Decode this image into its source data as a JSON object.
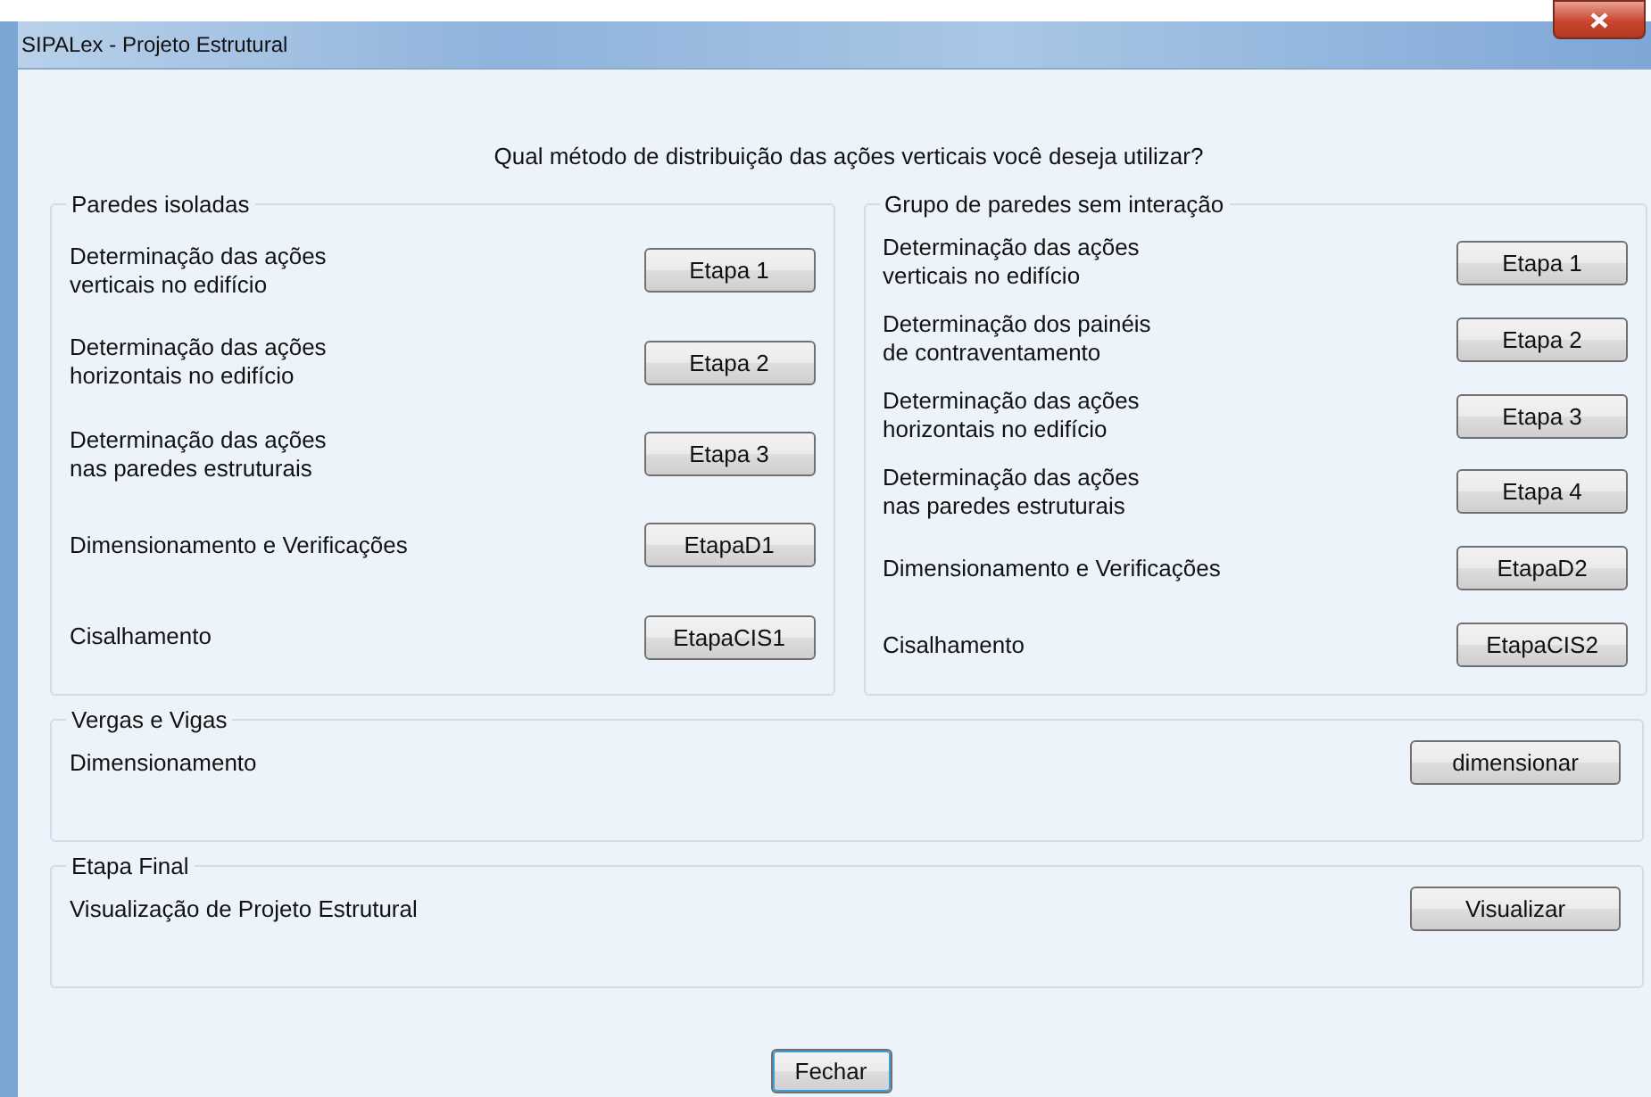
{
  "window": {
    "title": "SIPALex - Projeto Estrutural"
  },
  "question": "Qual método de distribuição das ações verticais você deseja utilizar?",
  "groups": [
    {
      "title": "Paredes isoladas",
      "rows": [
        {
          "label": "Determinação das ações\nverticais no edifício",
          "button": "Etapa 1"
        },
        {
          "label": "Determinação das ações\nhorizontais no edifício",
          "button": "Etapa 2"
        },
        {
          "label": "Determinação das ações\nnas paredes estruturais",
          "button": "Etapa 3"
        },
        {
          "label": "Dimensionamento e Verificações",
          "button": "EtapaD1"
        },
        {
          "label": "Cisalhamento",
          "button": "EtapaCIS1"
        }
      ]
    },
    {
      "title": "Grupo de paredes sem interação",
      "rows": [
        {
          "label": "Determinação das ações\nverticais no edifício",
          "button": "Etapa 1"
        },
        {
          "label": "Determinação dos painéis\nde contraventamento",
          "button": "Etapa 2"
        },
        {
          "label": "Determinação das ações\nhorizontais no edifício",
          "button": "Etapa 3"
        },
        {
          "label": "Determinação das ações\nnas paredes estruturais",
          "button": "Etapa 4"
        },
        {
          "label": "Dimensionamento e Verificações",
          "button": "EtapaD2"
        },
        {
          "label": "Cisalhamento",
          "button": "EtapaCIS2"
        }
      ]
    }
  ],
  "sections": [
    {
      "title": "Vergas e Vigas",
      "label": "Dimensionamento",
      "button": "dimensionar"
    },
    {
      "title": "Etapa Final",
      "label": "Visualização de Projeto Estrutural",
      "button": "Visualizar"
    }
  ],
  "close_button": "Fechar"
}
